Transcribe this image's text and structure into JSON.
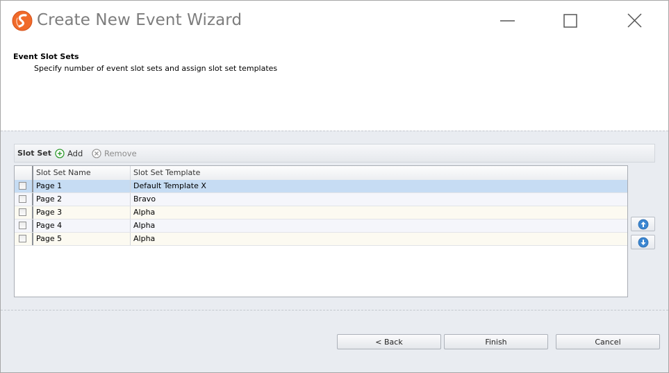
{
  "window": {
    "title": "Create New Event Wizard",
    "accent_color": "#f06a2a"
  },
  "header": {
    "title": "Event Slot Sets",
    "subtitle": "Specify number of event slot sets and assign slot set templates"
  },
  "toolbar": {
    "label": "Slot Set",
    "add_label": "Add",
    "remove_label": "Remove"
  },
  "grid": {
    "columns": [
      "Slot Set Name",
      "Slot Set Template"
    ],
    "rows": [
      {
        "name": "Page 1",
        "template": "Default Template X",
        "selected": true
      },
      {
        "name": "Page 2",
        "template": "Bravo"
      },
      {
        "name": "Page 3",
        "template": "Alpha"
      },
      {
        "name": "Page 4",
        "template": "Alpha"
      },
      {
        "name": "Page 5",
        "template": "Alpha"
      }
    ]
  },
  "buttons": {
    "back": "< Back",
    "finish": "Finish",
    "cancel": "Cancel"
  }
}
